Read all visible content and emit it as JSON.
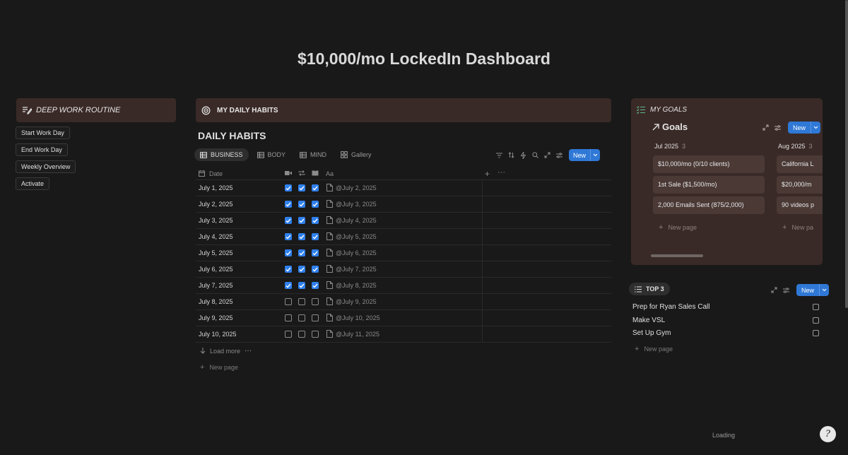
{
  "page_title": "$10,000/mo LockedIn Dashboard",
  "deep_work": {
    "title": "DEEP WORK ROUTINE",
    "buttons": [
      "Start Work Day",
      "End Work Day",
      "Weekly Overview",
      "Activate"
    ]
  },
  "habits": {
    "section_title": "MY DAILY HABITS",
    "db_title": "DAILY HABITS",
    "tabs": [
      {
        "label": "BUSINESS",
        "active": true
      },
      {
        "label": "BODY",
        "active": false
      },
      {
        "label": "MIND",
        "active": false
      },
      {
        "label": "Gallery",
        "active": false
      }
    ],
    "new_label": "New",
    "columns": {
      "date": "Date",
      "aa": "Aa"
    },
    "rows": [
      {
        "date": "July 1, 2025",
        "checks": [
          true,
          true,
          true
        ],
        "link": "@July 2, 2025"
      },
      {
        "date": "July 2, 2025",
        "checks": [
          true,
          true,
          true
        ],
        "link": "@July 3, 2025"
      },
      {
        "date": "July 3, 2025",
        "checks": [
          true,
          true,
          true
        ],
        "link": "@July 4, 2025"
      },
      {
        "date": "July 4, 2025",
        "checks": [
          true,
          true,
          true
        ],
        "link": "@July 5, 2025"
      },
      {
        "date": "July 5, 2025",
        "checks": [
          true,
          true,
          true
        ],
        "link": "@July 6, 2025"
      },
      {
        "date": "July 6, 2025",
        "checks": [
          true,
          true,
          true
        ],
        "link": "@July 7, 2025"
      },
      {
        "date": "July 7, 2025",
        "checks": [
          true,
          true,
          true
        ],
        "link": "@July 8, 2025"
      },
      {
        "date": "July 8, 2025",
        "checks": [
          false,
          false,
          false
        ],
        "link": "@July 9, 2025"
      },
      {
        "date": "July 9, 2025",
        "checks": [
          false,
          false,
          false
        ],
        "link": "@July 10, 2025"
      },
      {
        "date": "July 10, 2025",
        "checks": [
          false,
          false,
          false
        ],
        "link": "@July 11, 2025"
      }
    ],
    "load_more": "Load more",
    "new_page": "New page"
  },
  "goals": {
    "section_title": "MY GOALS",
    "sub_title": "Goals",
    "new_label": "New",
    "columns": [
      {
        "name": "Jul 2025",
        "count": "3",
        "cards": [
          "$10,000/mo (0/10 clients)",
          "1st Sale ($1,500/mo)",
          "2,000 Emails Sent (875/2,000)"
        ],
        "new_page": "New page"
      },
      {
        "name": "Aug 2025",
        "count": "3",
        "cards": [
          "California L",
          "$20,000/m",
          "90 videos p"
        ],
        "new_page": "New pa"
      }
    ]
  },
  "top3": {
    "title": "TOP 3",
    "new_label": "New",
    "items": [
      "Prep for Ryan Sales Call",
      "Make VSL",
      "Set Up Gym"
    ],
    "new_page": "New page"
  },
  "loading_text": "Loading",
  "colors": {
    "accent": "#2f78d6",
    "card_bg": "#3a2a27",
    "background": "#191919"
  }
}
